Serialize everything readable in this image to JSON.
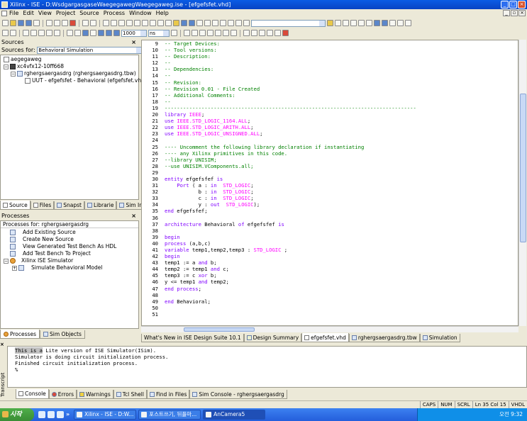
{
  "window": {
    "title": "Xilinx - ISE - D:WsdgargasgaseWaegegawegWaegegaweg.ise - [efgefsfet.vhd]"
  },
  "menu": [
    "File",
    "Edit",
    "View",
    "Project",
    "Source",
    "Process",
    "Window",
    "Help"
  ],
  "toolbar": {
    "sim_time": "1000",
    "sim_unit": "ns"
  },
  "sources": {
    "header": "Sources",
    "for_label": "Sources for:",
    "for_value": "Behavioral Simulation",
    "tree": [
      "aegegaweg",
      "xc4vfx12-10ff668",
      "rghergsaergasdrg (rghergsaergasdrg.tbw)",
      "UUT - efgefsfet - Behavioral (efgefsfet.vhd)"
    ],
    "tabs": [
      "Source",
      "Files",
      "Snapst",
      "Librarie",
      "Sim Insta"
    ]
  },
  "processes": {
    "header": "Processes",
    "for_label": "Processes for: rghergsaergasdrg",
    "items": [
      "Add Existing Source",
      "Create New Source",
      "View Generated Test Bench As HDL",
      "Add Test Bench To Project",
      "Xilinx ISE Simulator",
      "Simulate Behavioral Model"
    ],
    "tabs": [
      "Processes",
      "Sim Objects"
    ]
  },
  "editor": {
    "line_numbers": [
      "9",
      "10",
      "11",
      "12",
      "13",
      "14",
      "15",
      "16",
      "17",
      "18",
      "19",
      "20",
      "21",
      "22",
      "23",
      "24",
      "25",
      "26",
      "27",
      "28",
      "29",
      "30",
      "31",
      "32",
      "33",
      "34",
      "35",
      "36",
      "37",
      "38",
      "39",
      "40",
      "41",
      "42",
      "43",
      "44",
      "45",
      "46",
      "47",
      "48",
      "49",
      "50",
      "51"
    ],
    "lines": [
      "-- Target Devices:",
      "-- Tool versions:",
      "-- Description:",
      "--",
      "-- Dependencies:",
      "--",
      "-- Revision:",
      "-- Revision 0.01 - File Created",
      "-- Additional Comments:",
      "--",
      "----------------------------------------------------------------------------------",
      "library IEEE;",
      "use IEEE.STD_LOGIC_1164.ALL;",
      "use IEEE.STD_LOGIC_ARITH.ALL;",
      "use IEEE.STD_LOGIC_UNSIGNED.ALL;",
      "",
      "---- Uncomment the following library declaration if instantiating",
      "---- any Xilinx primitives in this code.",
      "--library UNISIM;",
      "--use UNISIM.VComponents.all;",
      "",
      "entity efgefsfef is",
      "    Port ( a : in  STD_LOGIC;",
      "           b : in  STD_LOGIC;",
      "           c : in  STD_LOGIC;",
      "           y : out  STD_LOGIC);",
      "end efgefsfef;",
      "",
      "architecture Behavioral of efgefsfef is",
      "",
      "begin",
      "process (a,b,c)",
      "variable temp1,temp2,temp3 : STD_LOGIC ;",
      "begin",
      "temp1 := a and b;",
      "temp2 := temp1 and c;",
      "temp3 := c xor b;",
      "y <= temp1 and temp2;",
      "end process;",
      "",
      "end Behavioral;",
      "",
      ""
    ],
    "tabs": [
      "What's New in ISE Design Suite 10.1",
      "Design Summary",
      "efgefsfet.vhd",
      "rghergsaergasdrg.tbw",
      "Simulation"
    ]
  },
  "console": {
    "side_label": "Transcript",
    "lines": [
      "This is a Lite version of ISE Simulator(ISim).",
      "Simulator is doing circuit initialization process.",
      "Finished circuit initialization process.",
      "%"
    ],
    "tabs": [
      "Console",
      "Errors",
      "Warnings",
      "Tcl Shell",
      "Find in Files",
      "Sim Console - rghergsaergasdrg"
    ]
  },
  "status": [
    "CAPS",
    "NUM",
    "SCRL",
    "Ln 35 Col 15",
    "VHDL"
  ],
  "taskbar": {
    "start": "시작",
    "more": "»",
    "tasks": [
      "Xilinx - ISE - D:W...",
      "포스트쓰기, 뒤플마...",
      "AnCamera5"
    ],
    "clock": "오전 9:32"
  }
}
